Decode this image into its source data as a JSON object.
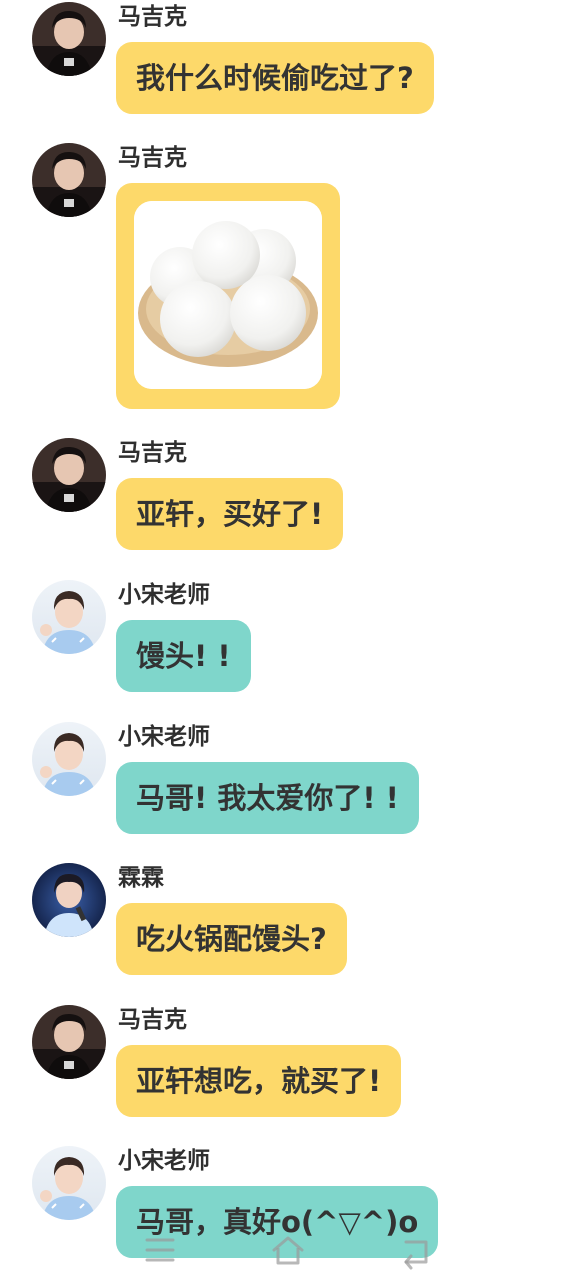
{
  "colors": {
    "yellow_bubble": "#fdd96a",
    "teal_bubble": "#7fd6cb",
    "name_text": "#2f2f2f",
    "bubble_text": "#333333"
  },
  "messages": [
    {
      "sender": "马吉克",
      "avatar": "majike-avatar",
      "bubble_color": "yellow",
      "type": "text",
      "text": "我什么时候偷吃过了?"
    },
    {
      "sender": "马吉克",
      "avatar": "majike-avatar",
      "bubble_color": "yellow",
      "type": "image",
      "image": "steamed-buns-photo"
    },
    {
      "sender": "马吉克",
      "avatar": "majike-avatar",
      "bubble_color": "yellow",
      "type": "text",
      "text": "亚轩，买好了!"
    },
    {
      "sender": "小宋老师",
      "avatar": "xiaosong-avatar",
      "bubble_color": "teal",
      "type": "text",
      "text": "馒头! !"
    },
    {
      "sender": "小宋老师",
      "avatar": "xiaosong-avatar",
      "bubble_color": "teal",
      "type": "text",
      "text": "马哥! 我太爱你了! !"
    },
    {
      "sender": "霖霖",
      "avatar": "linlin-avatar",
      "bubble_color": "yellow",
      "type": "text",
      "text": "吃火锅配馒头?"
    },
    {
      "sender": "马吉克",
      "avatar": "majike-avatar",
      "bubble_color": "yellow",
      "type": "text",
      "text": "亚轩想吃，就买了!"
    },
    {
      "sender": "小宋老师",
      "avatar": "xiaosong-avatar",
      "bubble_color": "teal",
      "type": "text",
      "text": "马哥，真好o(^▽^)o"
    }
  ],
  "navbar": {
    "icons": [
      "menu-icon",
      "home-icon",
      "back-icon"
    ]
  }
}
